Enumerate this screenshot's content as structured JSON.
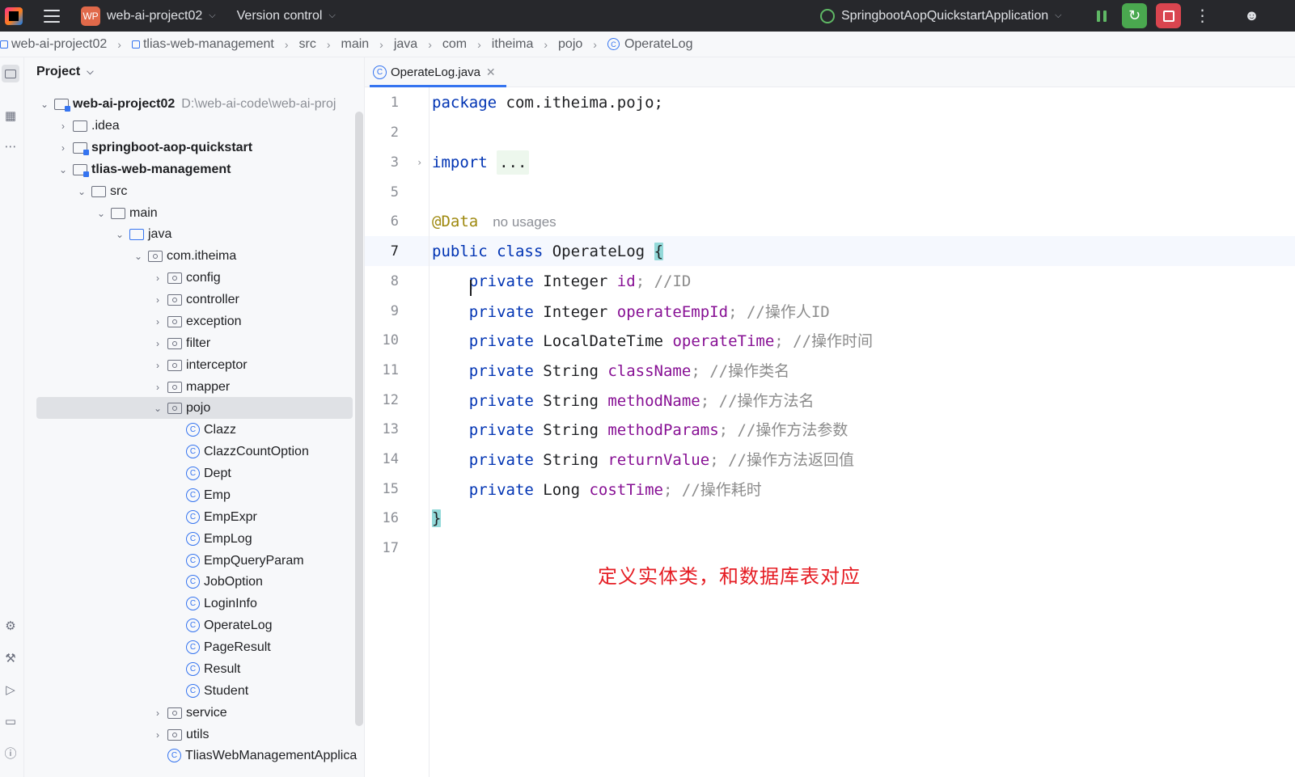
{
  "titlebar": {
    "project_badge": "WP",
    "project_name": "web-ai-project02",
    "vcs_label": "Version control",
    "run_config": "SpringbootAopQuickstartApplication"
  },
  "breadcrumb": {
    "items": [
      "web-ai-project02",
      "tlias-web-management",
      "src",
      "main",
      "java",
      "com",
      "itheima",
      "pojo",
      "OperateLog"
    ]
  },
  "project_panel": {
    "title": "Project",
    "root_path": "D:\\web-ai-code\\web-ai-proj",
    "tree": [
      {
        "label": "web-ai-project02"
      },
      {
        "label": ".idea"
      },
      {
        "label": "springboot-aop-quickstart"
      },
      {
        "label": "tlias-web-management"
      },
      {
        "label": "src"
      },
      {
        "label": "main"
      },
      {
        "label": "java"
      },
      {
        "label": "com.itheima"
      },
      {
        "label": "config"
      },
      {
        "label": "controller"
      },
      {
        "label": "exception"
      },
      {
        "label": "filter"
      },
      {
        "label": "interceptor"
      },
      {
        "label": "mapper"
      },
      {
        "label": "pojo"
      },
      {
        "label": "Clazz"
      },
      {
        "label": "ClazzCountOption"
      },
      {
        "label": "Dept"
      },
      {
        "label": "Emp"
      },
      {
        "label": "EmpExpr"
      },
      {
        "label": "EmpLog"
      },
      {
        "label": "EmpQueryParam"
      },
      {
        "label": "JobOption"
      },
      {
        "label": "LoginInfo"
      },
      {
        "label": "OperateLog"
      },
      {
        "label": "PageResult"
      },
      {
        "label": "Result"
      },
      {
        "label": "Student"
      },
      {
        "label": "service"
      },
      {
        "label": "utils"
      },
      {
        "label": "TliasWebManagementApplica"
      }
    ]
  },
  "editor": {
    "tab_label": "OperateLog.java",
    "line_numbers": [
      "1",
      "2",
      "3",
      "5",
      "6",
      "7",
      "8",
      "9",
      "10",
      "11",
      "12",
      "13",
      "14",
      "15",
      "16",
      "17"
    ],
    "code": {
      "l1_kw": "package",
      "l1_rest": " com.itheima.pojo;",
      "l3_kw": "import",
      "l3_folded": "...",
      "l6_ann": "@Data",
      "l6_hint": "no usages",
      "l7_kw": "public class",
      "l7_name": " OperateLog ",
      "l7_brace": "{",
      "fields": [
        {
          "mod": "private",
          "type": " Integer ",
          "name": "id",
          "comment": "; //ID"
        },
        {
          "mod": "private",
          "type": " Integer ",
          "name": "operateEmpId",
          "comment": "; //操作人ID"
        },
        {
          "mod": "private",
          "type": " LocalDateTime ",
          "name": "operateTime",
          "comment": "; //操作时间"
        },
        {
          "mod": "private",
          "type": " String ",
          "name": "className",
          "comment": "; //操作类名"
        },
        {
          "mod": "private",
          "type": " String ",
          "name": "methodName",
          "comment": "; //操作方法名"
        },
        {
          "mod": "private",
          "type": " String ",
          "name": "methodParams",
          "comment": "; //操作方法参数"
        },
        {
          "mod": "private",
          "type": " String ",
          "name": "returnValue",
          "comment": "; //操作方法返回值"
        },
        {
          "mod": "private",
          "type": " Long ",
          "name": "costTime",
          "comment": "; //操作耗时"
        }
      ],
      "l16_brace": "}"
    },
    "overlay_note": "定义实体类，和数据库表对应"
  },
  "colors": {
    "accent": "#3574f0",
    "keyword": "#0033b3",
    "field": "#871094",
    "annotation": "#9e880d",
    "comment": "#8c8c8c",
    "overlay_note": "#e51c23"
  }
}
